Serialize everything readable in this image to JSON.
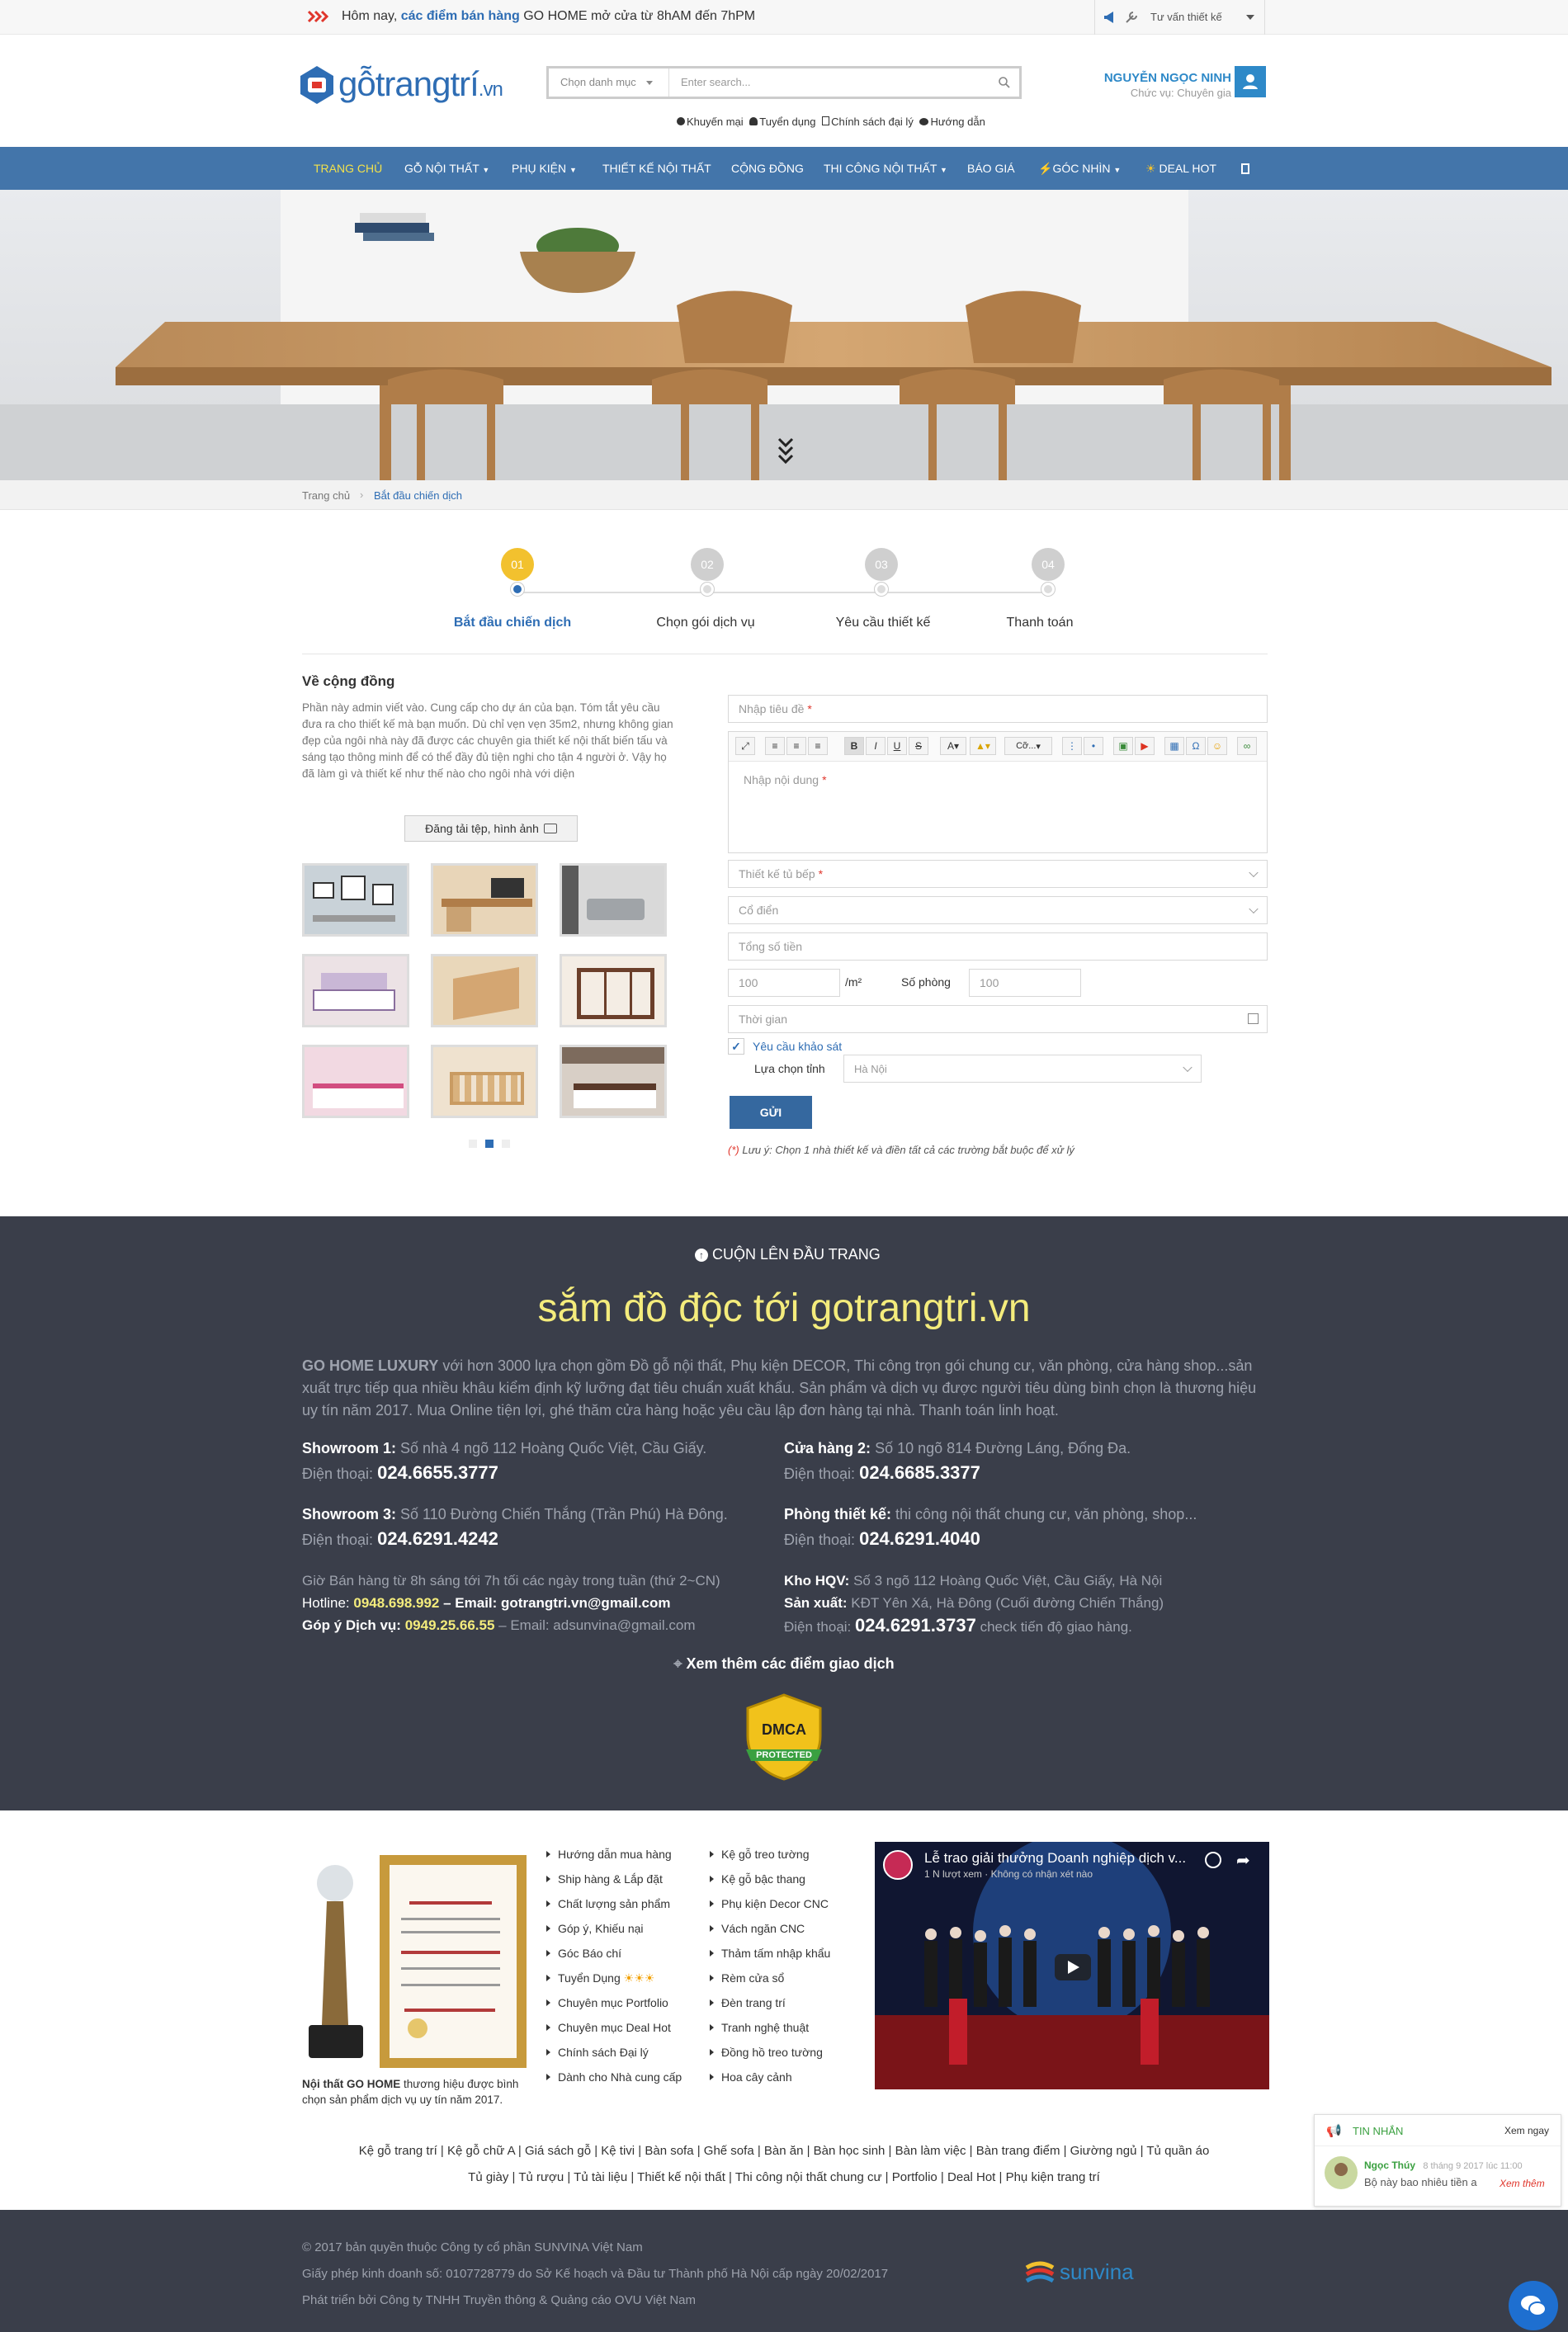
{
  "topbar": {
    "notice_prefix": "Hôm nay,",
    "notice_link": "các điểm bán hàng",
    "notice_suffix": "GO HOME mở cửa từ 8hAM đến 7hPM",
    "consult_label": "Tư vấn thiết kế"
  },
  "header": {
    "logo_text": "gỗtrangtrí",
    "logo_tld": ".vn",
    "category_placeholder": "Chọn danh mục",
    "search_placeholder": "Enter search...",
    "quick_links": [
      "Khuyến mại",
      "Tuyển dụng",
      "Chính sách đại lý",
      "Hướng dẫn"
    ],
    "user_name": "NGUYỄN NGỌC NINH",
    "user_role": "Chức vụ: Chuyên gia"
  },
  "nav": {
    "items": [
      "TRANG CHỦ",
      "GỖ NỘI THẤT",
      "PHỤ KIỆN",
      "THIẾT KẾ NỘI THẤT",
      "CỘNG ĐỒNG",
      "THI CÔNG NỘI THẤT",
      "BÁO GIÁ",
      "GÓC NHÌN",
      "DEAL HOT"
    ]
  },
  "breadcrumb": {
    "home": "Trang chủ",
    "current": "Bắt đầu chiến dịch"
  },
  "steps": [
    {
      "num": "01",
      "label": "Bắt đầu chiến dịch"
    },
    {
      "num": "02",
      "label": "Chọn gói dịch vụ"
    },
    {
      "num": "03",
      "label": "Yêu cầu thiết kế"
    },
    {
      "num": "04",
      "label": "Thanh toán"
    }
  ],
  "community": {
    "title": "Về cộng đồng",
    "body": "Phần này admin viết vào. Cung cấp cho dự án của bạn. Tóm tắt yêu cầu đưa ra cho thiết kế mà bạn muốn. Dù chỉ vẹn vẹn 35m2, nhưng không gian đẹp của ngôi nhà này đã được các chuyên gia thiết kế nội thất biến tấu và sáng tạo thông minh để có thể đầy đủ tiện nghi cho tận 4 người ở. Vậy họ đã làm gì và thiết kế như thế nào cho ngôi nhà với diện",
    "upload_label": "Đăng tải tệp, hình ảnh"
  },
  "form": {
    "title_placeholder": "Nhập tiêu đề",
    "content_placeholder": "Nhập nội dung",
    "font_select": "Cỡ...",
    "design_select": "Thiết kế tủ bếp",
    "style_select": "Cổ điển",
    "total_placeholder": "Tổng số tiền",
    "area_value": "100",
    "area_unit": "/m²",
    "rooms_label": "Số phòng",
    "rooms_value": "100",
    "time_placeholder": "Thời gian",
    "survey_label": "Yêu cầu khảo sát",
    "province_label": "Lựa chọn tỉnh",
    "province_value": "Hà Nội",
    "submit_label": "GỬI",
    "note_mark": "(*)",
    "note_text": "Lưu ý: Chọn 1 nhà thiết kế và điền tất cả các trường bắt buộc để xử lý"
  },
  "darkfooter": {
    "scroll_top": "CUỘN LÊN ĐẦU TRANG",
    "slogan": "sắm đồ độc tới gotrangtri.vn",
    "intro_brand": "GO HOME LUXURY",
    "intro_text": "với hơn 3000 lựa chọn gồm Đồ gỗ nội thất, Phụ kiện DECOR, Thi công trọn gói chung cư, văn phòng, cửa hàng shop...sản xuất trực tiếp qua nhiều khâu kiểm định kỹ lưỡng đạt tiêu chuẩn xuất khẩu. Sản phẩm và dịch vụ được người tiêu dùng bình chọn là thương hiệu uy tín năm 2017. Mua Online tiện lợi, ghé thăm cửa hàng hoặc yêu cầu lập đơn hàng tại nhà. Thanh toán linh hoạt.",
    "locations": [
      {
        "label": "Showroom 1:",
        "addr": "Số nhà 4 ngõ 112 Hoàng Quốc Việt, Cầu Giấy.",
        "phone_label": "Điện thoại:",
        "phone": "024.6655.3777"
      },
      {
        "label": "Cửa hàng 2:",
        "addr": "Số 10 ngõ 814 Đường Láng, Đống Đa.",
        "phone_label": "Điện thoại:",
        "phone": "024.6685.3377"
      },
      {
        "label": "Showroom 3:",
        "addr": "Số 110 Đường Chiến Thắng (Trần Phú) Hà Đông.",
        "phone_label": "Điện thoại:",
        "phone": "024.6291.4242"
      },
      {
        "label": "Phòng thiết kế:",
        "addr": "thi công nội thất chung cư, văn phòng, shop...",
        "phone_label": "Điện thoại:",
        "phone": "024.6291.4040"
      }
    ],
    "hours": "Giờ Bán hàng từ 8h sáng tới 7h tối các ngày trong tuần (thứ 2~CN)",
    "hotline_label": "Hotline:",
    "hotline": "0948.698.992",
    "email_label": "– Email: gotrangtri.vn@gmail.com",
    "feedback_label": "Góp ý Dịch vụ:",
    "feedback_phone": "0949.25.66.55",
    "feedback_email": "– Email: adsunvina@gmail.com",
    "warehouse_label": "Kho HQV:",
    "warehouse_addr": "Số 3 ngõ 112 Hoàng Quốc Việt, Cầu Giấy, Hà Nội",
    "factory_label": "Sản xuất:",
    "factory_addr": "KĐT Yên Xá, Hà Đông (Cuối đường Chiến Thắng)",
    "factory_phone_label": "Điện thoại:",
    "factory_phone": "024.6291.3737",
    "factory_phone_note": "check tiến độ giao hàng.",
    "more_locations": "Xem thêm các điểm giao dịch",
    "dmca_top": "DMCA",
    "dmca_bottom": "PROTECTED"
  },
  "lightfooter": {
    "award_brand": "Nội thất GO HOME",
    "award_text": "thương hiệu được bình chọn sản phẩm dịch vụ uy tín năm 2017.",
    "links_col1": [
      "Hướng dẫn mua hàng",
      "Ship hàng & Lắp đặt",
      "Chất lượng sản phẩm",
      "Góp ý, Khiếu nại",
      "Góc Báo chí",
      "Tuyển Dụng",
      "Chuyên mục Portfolio",
      "Chuyên mục Deal Hot",
      "Chính sách Đại lý",
      "Dành cho Nhà cung cấp"
    ],
    "links_col2": [
      "Kệ gỗ treo tường",
      "Kệ gỗ bậc thang",
      "Phụ kiện Decor CNC",
      "Vách ngăn CNC",
      "Thảm tấm nhập khẩu",
      "Rèm cửa sổ",
      "Đèn trang trí",
      "Tranh nghệ thuật",
      "Đồng hồ treo tường",
      "Hoa cây cảnh"
    ],
    "video_title": "Lễ trao giải thưởng Doanh nghiệp dịch v...",
    "video_meta": "1 N lượt xem · Không có nhận xét nào",
    "tags_line1": "Kệ gỗ trang trí | Kệ gỗ chữ A | Giá sách gỗ | Kệ tivi | Bàn sofa | Ghế sofa | Bàn ăn | Bàn học sinh | Bàn làm việc | Bàn trang điểm | Giường ngủ | Tủ quần áo",
    "tags_line2": "Tủ giày | Tủ rượu | Tủ tài liệu | Thiết kế nội thất | Thi công nội thất chung cư | Portfolio | Deal Hot | Phụ kiện trang trí"
  },
  "bottom": {
    "copyright": "© 2017 bản quyền thuộc Công ty cổ phần SUNVINA Việt Nam",
    "license": "Giấy phép kinh doanh số: 0107728779 do Sở Kế hoạch và Đầu tư Thành phố Hà Nội cấp ngày 20/02/2017",
    "developer": "Phát triển bởi Công ty TNHH Truyền thông & Quảng cáo OVU Việt Nam",
    "partner_logo": "sunvina"
  },
  "chat": {
    "header": "TIN NHẮN",
    "view_all": "Xem ngay",
    "sender": "Ngọc Thúy",
    "time": "8 tháng 9 2017 lúc 11:00",
    "message": "Bộ này bao nhiêu tiền a",
    "view_more": "Xem thêm"
  },
  "colors": {
    "nav": "#4375aa",
    "accent": "#f2c12e",
    "dark": "#3a3e4a",
    "slogan": "#f4ec7c",
    "brand_blue": "#2e6db4"
  }
}
